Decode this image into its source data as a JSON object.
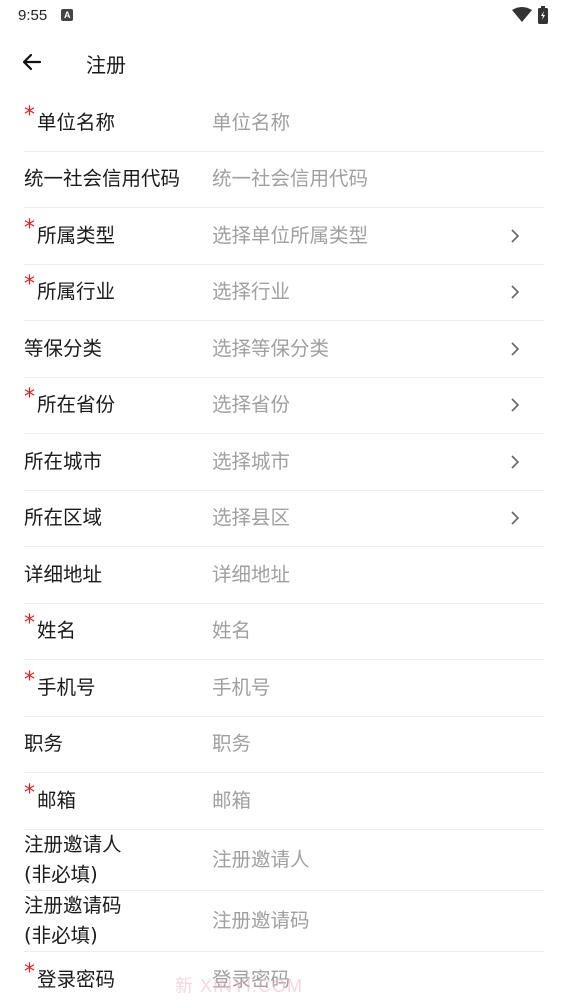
{
  "status_bar": {
    "time": "9:55",
    "a_badge": "A"
  },
  "header": {
    "title": "注册"
  },
  "form": {
    "fields": [
      {
        "label": "单位名称",
        "required": true,
        "placeholder": "单位名称",
        "selector": false
      },
      {
        "label": "统一社会信用代码",
        "required": false,
        "placeholder": "统一社会信用代码",
        "selector": false
      },
      {
        "label": "所属类型",
        "required": true,
        "placeholder": "选择单位所属类型",
        "selector": true
      },
      {
        "label": "所属行业",
        "required": true,
        "placeholder": "选择行业",
        "selector": true
      },
      {
        "label": "等保分类",
        "required": false,
        "placeholder": "选择等保分类",
        "selector": true
      },
      {
        "label": "所在省份",
        "required": true,
        "placeholder": "选择省份",
        "selector": true
      },
      {
        "label": "所在城市",
        "required": false,
        "placeholder": "选择城市",
        "selector": true
      },
      {
        "label": "所在区域",
        "required": false,
        "placeholder": "选择县区",
        "selector": true
      },
      {
        "label": "详细地址",
        "required": false,
        "placeholder": "详细地址",
        "selector": false
      },
      {
        "label": "姓名",
        "required": true,
        "placeholder": "姓名",
        "selector": false
      },
      {
        "label": "手机号",
        "required": true,
        "placeholder": "手机号",
        "selector": false
      },
      {
        "label": "职务",
        "required": false,
        "placeholder": "职务",
        "selector": false
      },
      {
        "label": "邮箱",
        "required": true,
        "placeholder": "邮箱",
        "selector": false
      },
      {
        "label": "注册邀请人",
        "label_note": "(非必填)",
        "required": false,
        "placeholder": "注册邀请人",
        "selector": false
      },
      {
        "label": "注册邀请码",
        "label_note": "(非必填)",
        "required": false,
        "placeholder": "注册邀请码",
        "selector": false
      },
      {
        "label": "登录密码",
        "required": true,
        "placeholder": "登录密码",
        "selector": false
      }
    ],
    "required_mark": "*"
  },
  "watermark": {
    "text": "新 XINYI.COM"
  },
  "colors": {
    "required": "#e02020",
    "placeholder": "#a0a0a0",
    "divider": "#eeeeee",
    "text": "#1a1a1a"
  }
}
